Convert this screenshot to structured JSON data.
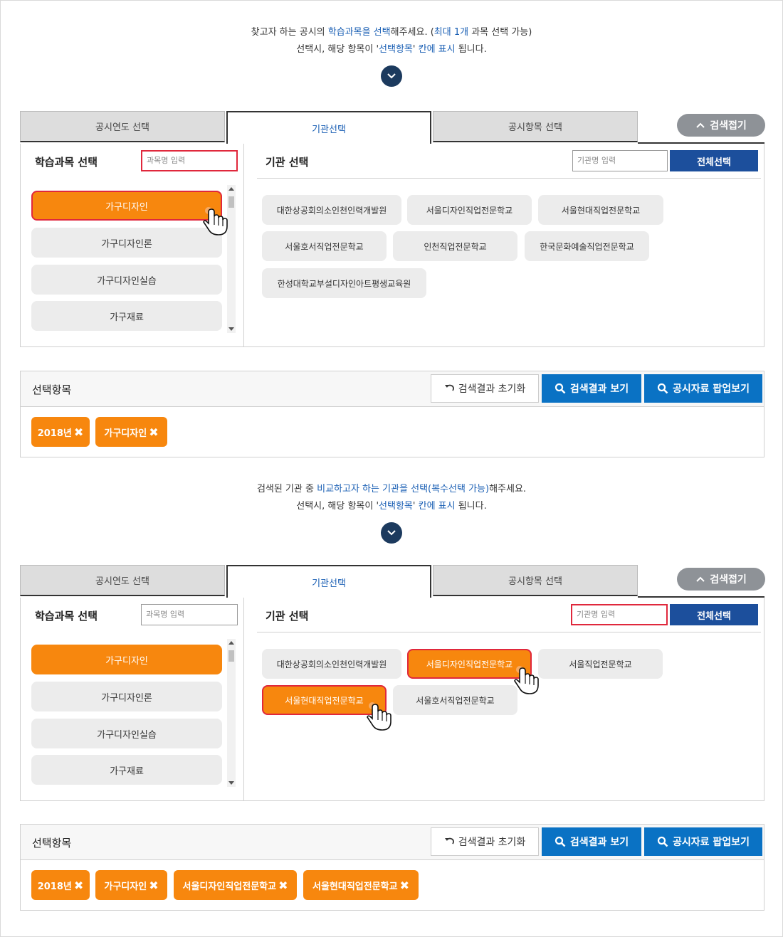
{
  "section1": {
    "guide_line1": {
      "a": "찾고자 하는 공시의 ",
      "b": "학습과목을 선택",
      "c": "해주세요. (",
      "d": "최대 1개",
      "e": " 과목 선택 가능)"
    },
    "guide_line2": {
      "a": "선택시, 해당 항목이 '",
      "b": "선택항목",
      "c": "' ",
      "d": "칸에 표시",
      "e": " 됩니다."
    },
    "tabs": [
      "공시연도 선택",
      "기관선택",
      "공시항목 선택"
    ],
    "fold_label": "검색접기",
    "left_title": "학습과목 선택",
    "course_placeholder": "과목명 입력",
    "courses": [
      "가구디자인",
      "가구디자인론",
      "가구디자인실습",
      "가구재료"
    ],
    "right_title": "기관 선택",
    "inst_placeholder": "기관명 입력",
    "select_all": "전체선택",
    "institutions": [
      "대한상공회의소인천인력개발원",
      "서울디자인직업전문학교",
      "서울현대직업전문학교",
      "서울호서직업전문학교",
      "인천직업전문학교",
      "한국문화예술직업전문학교",
      "한성대학교부설디자인아트평생교육원"
    ],
    "selected_title": "선택항목",
    "reset_label": "검색결과 초기화",
    "view_label": "검색결과 보기",
    "popup_label": "공시자료 팝업보기",
    "chips": [
      "2018년",
      "가구디자인"
    ]
  },
  "section2": {
    "guide_line1": {
      "a": "검색된 기관 중 ",
      "b": "비교하고자 하는 기관을 선택(복수선택 가능)",
      "c": "해주세요."
    },
    "guide_line2": {
      "a": "선택시, 해당 항목이 '",
      "b": "선택항목",
      "c": "' ",
      "d": "칸에 표시",
      "e": " 됩니다."
    },
    "tabs": [
      "공시연도 선택",
      "기관선택",
      "공시항목 선택"
    ],
    "fold_label": "검색접기",
    "left_title": "학습과목 선택",
    "course_placeholder": "과목명 입력",
    "courses": [
      "가구디자인",
      "가구디자인론",
      "가구디자인실습",
      "가구재료"
    ],
    "right_title": "기관 선택",
    "inst_placeholder": "기관명 입력",
    "select_all": "전체선택",
    "institutions": [
      "대한상공회의소인천인력개발원",
      "서울디자인직업전문학교",
      "서울직업전문학교",
      "서울현대직업전문학교",
      "서울호서직업전문학교"
    ],
    "selected_title": "선택항목",
    "reset_label": "검색결과 초기화",
    "view_label": "검색결과 보기",
    "popup_label": "공시자료 팝업보기",
    "chips": [
      "2018년",
      "가구디자인",
      "서울디자인직업전문학교",
      "서울현대직업전문학교"
    ]
  },
  "colors": {
    "accent_orange": "#f7870e",
    "highlight_red": "#e0283c",
    "primary_blue": "#0a72c4",
    "navy": "#1c4f9c",
    "link_blue": "#1a5fb4"
  },
  "icons": [
    "chevron-down-icon",
    "chevron-up-icon",
    "reset-icon",
    "search-icon",
    "close-icon",
    "hand-cursor-icon"
  ]
}
